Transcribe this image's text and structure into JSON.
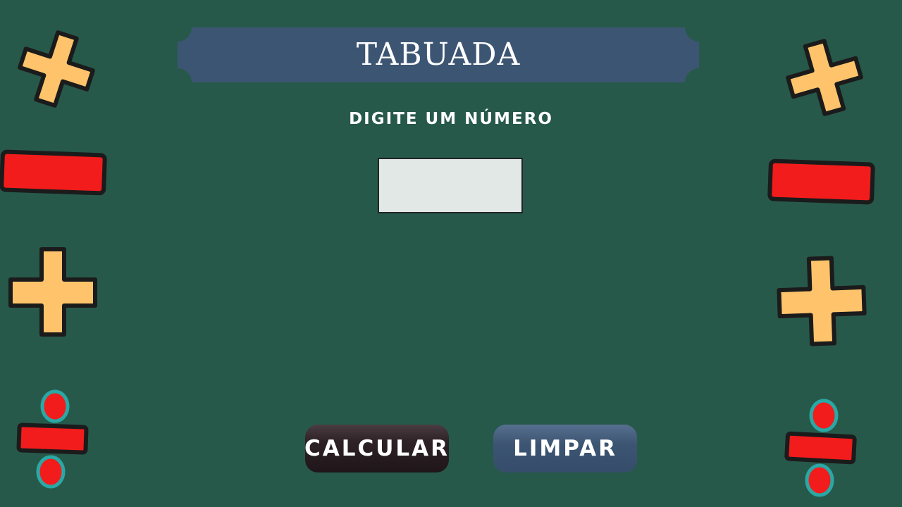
{
  "app": {
    "title": "TABUADA"
  },
  "form": {
    "prompt_label": "DIGITE UM NÚMERO",
    "number_value": "",
    "number_placeholder": ""
  },
  "actions": {
    "calculate_label": "CALCULAR",
    "clear_label": "LIMPAR"
  },
  "decorations": {
    "left": [
      "plus-icon",
      "minus-icon",
      "plus-icon",
      "divide-icon"
    ],
    "right": [
      "plus-icon",
      "minus-icon",
      "plus-icon",
      "divide-icon"
    ]
  },
  "colors": {
    "background": "#27594b",
    "banner": "#3c5572",
    "plus": "#ffc46b",
    "minus": "#f21c1c",
    "divide_dot_ring": "#2aa8a5",
    "outline": "#1b1b1b",
    "input_bg": "#e2e8e5",
    "calculate_button": "#2e2226",
    "clear_button": "#3c5572"
  }
}
